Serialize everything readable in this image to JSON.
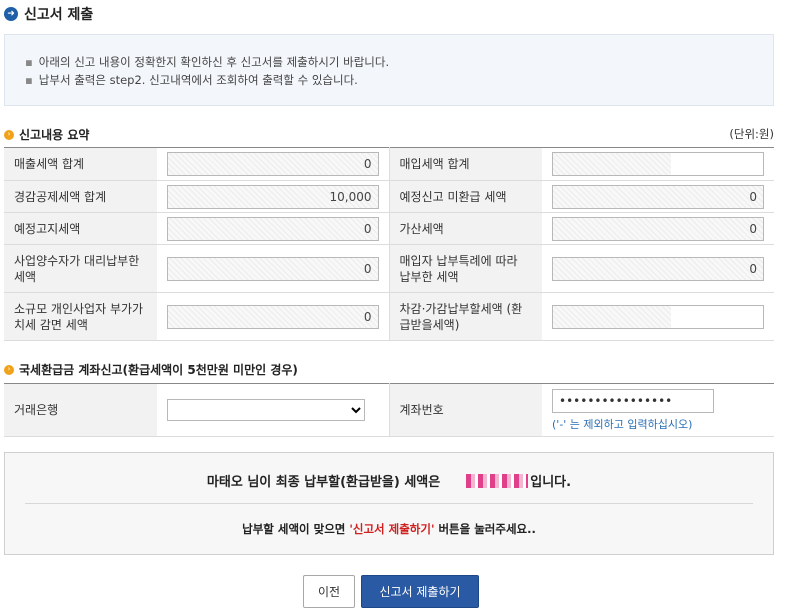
{
  "page": {
    "title": "신고서 제출"
  },
  "notice": {
    "lines": [
      "아래의 신고 내용이 정확한지 확인하신 후 신고서를 제출하시기 바랍니다.",
      "납부서 출력은 step2. 신고내역에서 조회하여 출력할 수 있습니다."
    ]
  },
  "summary_section": {
    "title": "신고내용 요약",
    "unit": "(단위:원)",
    "rows": [
      {
        "left_label": "매출세액 합계",
        "left_value": "0",
        "right_label": "매입세액 합계",
        "right_value": ""
      },
      {
        "left_label": "경감공제세액 합계",
        "left_value": "10,000",
        "right_label": "예정신고 미환급 세액",
        "right_value": "0"
      },
      {
        "left_label": "예정고지세액",
        "left_value": "0",
        "right_label": "가산세액",
        "right_value": "0"
      },
      {
        "left_label": "사업양수자가 대리납부한 세액",
        "left_value": "0",
        "right_label": "매입자 납부특례에 따라 납부한 세액",
        "right_value": "0"
      },
      {
        "left_label": "소규모 개인사업자 부가가치세 감면 세액",
        "left_value": "0",
        "right_label": "차감·가감납부할세액 (환급받을세액)",
        "right_value": ""
      }
    ]
  },
  "refund_section": {
    "title": "국세환급금 계좌신고(환급세액이 5천만원 미만인 경우)",
    "bank_label": "거래은행",
    "bank_selected": "",
    "account_label": "계좌번호",
    "account_value": "••••••••••••••••",
    "account_hint": "('-' 는 제외하고 입력하십시오)"
  },
  "final_box": {
    "line1_prefix": "마태오 님이 최종 납부할(환급받을) 세액은",
    "line1_suffix": "입니다.",
    "line2_prefix": "납부할 세액이 맞으면 ",
    "line2_highlight": "'신고서 제출하기'",
    "line2_suffix": " 버튼을 눌러주세요.."
  },
  "buttons": {
    "prev": "이전",
    "submit": "신고서 제출하기"
  },
  "colors": {
    "accent": "#2b5aa5",
    "section_dot": "#f0a21a",
    "highlight": "#d02020",
    "hint": "#2a6fb5"
  }
}
